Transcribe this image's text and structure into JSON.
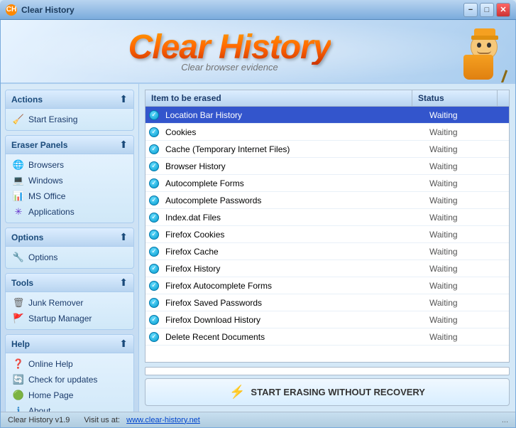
{
  "titleBar": {
    "icon": "CH",
    "title": "Clear History",
    "minBtn": "−",
    "maxBtn": "□",
    "closeBtn": "✕"
  },
  "header": {
    "logoText": "Clear History",
    "subtitle": "Clear browser evidence"
  },
  "sidebar": {
    "sections": [
      {
        "id": "actions",
        "title": "Actions",
        "items": [
          {
            "id": "start-erasing",
            "label": "Start Erasing",
            "icon": "eraser"
          }
        ]
      },
      {
        "id": "eraser-panels",
        "title": "Eraser Panels",
        "items": [
          {
            "id": "browsers",
            "label": "Browsers",
            "icon": "globe"
          },
          {
            "id": "windows",
            "label": "Windows",
            "icon": "windows"
          },
          {
            "id": "ms-office",
            "label": "MS Office",
            "icon": "ms"
          },
          {
            "id": "applications",
            "label": "Applications",
            "icon": "apps"
          }
        ]
      },
      {
        "id": "options",
        "title": "Options",
        "items": [
          {
            "id": "options",
            "label": "Options",
            "icon": "options"
          }
        ]
      },
      {
        "id": "tools",
        "title": "Tools",
        "items": [
          {
            "id": "junk-remover",
            "label": "Junk Remover",
            "icon": "trash"
          },
          {
            "id": "startup-manager",
            "label": "Startup Manager",
            "icon": "startup"
          }
        ]
      },
      {
        "id": "help",
        "title": "Help",
        "items": [
          {
            "id": "online-help",
            "label": "Online Help",
            "icon": "help"
          },
          {
            "id": "check-updates",
            "label": "Check for updates",
            "icon": "update"
          },
          {
            "id": "home-page",
            "label": "Home Page",
            "icon": "home"
          },
          {
            "id": "about",
            "label": "About",
            "icon": "info"
          }
        ]
      }
    ]
  },
  "table": {
    "headers": {
      "item": "Item to be erased",
      "status": "Status"
    },
    "rows": [
      {
        "name": "Location Bar History",
        "status": "Waiting",
        "selected": true
      },
      {
        "name": "Cookies",
        "status": "Waiting",
        "selected": false
      },
      {
        "name": "Cache (Temporary Internet Files)",
        "status": "Waiting",
        "selected": false
      },
      {
        "name": "Browser History",
        "status": "Waiting",
        "selected": false
      },
      {
        "name": "Autocomplete Forms",
        "status": "Waiting",
        "selected": false
      },
      {
        "name": "Autocomplete Passwords",
        "status": "Waiting",
        "selected": false
      },
      {
        "name": "Index.dat Files",
        "status": "Waiting",
        "selected": false
      },
      {
        "name": "Firefox Cookies",
        "status": "Waiting",
        "selected": false
      },
      {
        "name": "Firefox Cache",
        "status": "Waiting",
        "selected": false
      },
      {
        "name": "Firefox History",
        "status": "Waiting",
        "selected": false
      },
      {
        "name": "Firefox Autocomplete Forms",
        "status": "Waiting",
        "selected": false
      },
      {
        "name": "Firefox Saved Passwords",
        "status": "Waiting",
        "selected": false
      },
      {
        "name": "Firefox Download History",
        "status": "Waiting",
        "selected": false
      },
      {
        "name": "Delete Recent Documents",
        "status": "Waiting",
        "selected": false
      }
    ]
  },
  "startButton": {
    "label": "START ERASING WITHOUT RECOVERY"
  },
  "statusBar": {
    "version": "Clear History v1.9",
    "visitLabel": "Visit us at:",
    "link": "www.clear-history.net",
    "dots": "..."
  },
  "icons": {
    "eraser": "🧹",
    "globe": "🌐",
    "windows": "🖥",
    "ms": "📊",
    "apps": "✳",
    "options": "🔧",
    "trash": "🗑",
    "startup": "🚀",
    "help": "❓",
    "update": "🔄",
    "home": "🏠",
    "info": "ℹ"
  }
}
